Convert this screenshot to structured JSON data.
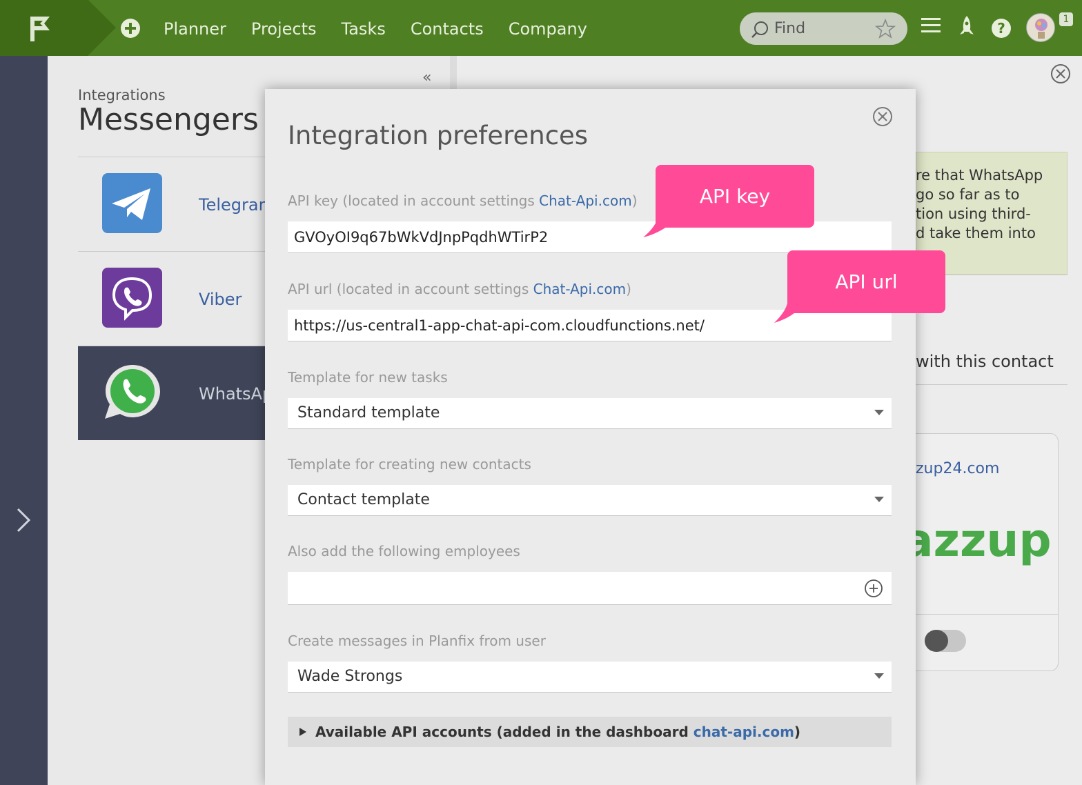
{
  "topbar": {
    "nav": [
      "Planner",
      "Projects",
      "Tasks",
      "Contacts",
      "Company"
    ],
    "search_placeholder": "Find",
    "notification_count": "1"
  },
  "left": {
    "breadcrumb": "Integrations",
    "title": "Messengers",
    "messengers": [
      {
        "label": "Telegram",
        "active": false
      },
      {
        "label": "Viber",
        "active": false
      },
      {
        "label": "WhatsApp",
        "active": true
      }
    ]
  },
  "right": {
    "note_text": "re that WhatsApp\ngo so far as to\ntion using third-\nd take them into",
    "contact_text": "with this contact",
    "card_link": "zup24.com",
    "brand_text": "azzup"
  },
  "modal": {
    "title": "Integration preferences",
    "api_key_label_prefix": "API key (located in account settings ",
    "api_key_label_link": "Chat-Api.com",
    "api_key_label_suffix": ")",
    "api_key_value": "GVOyOI9q67bWkVdJnpPqdhWTirP2",
    "api_url_label_prefix": "API url (located in account settings ",
    "api_url_label_link": "Chat-Api.com",
    "api_url_label_suffix": ")",
    "api_url_value": "https://us-central1-app-chat-api-com.cloudfunctions.net/",
    "template_tasks_label": "Template for new tasks",
    "template_tasks_value": "Standard template",
    "template_contacts_label": "Template for creating new contacts",
    "template_contacts_value": "Contact template",
    "employees_label": "Also add the following employees",
    "employees_value": "",
    "messages_user_label": "Create messages in Planfix from user",
    "messages_user_value": "Wade Strongs",
    "accounts_prefix": "Available API accounts (added in the dashboard ",
    "accounts_link": "chat-api.com",
    "accounts_suffix": ")"
  },
  "callouts": {
    "api_key": "API key",
    "api_url": "API url"
  },
  "colors": {
    "topbar": "#4e7f23",
    "rail": "#3f4458",
    "callout": "#ff4a98",
    "link": "#3a6aa8"
  }
}
